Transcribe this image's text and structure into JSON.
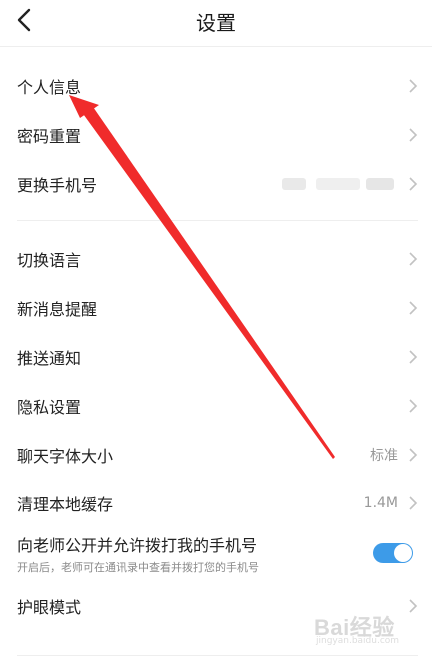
{
  "header": {
    "title": "设置",
    "back_icon": "chevron-left-icon"
  },
  "sections": [
    {
      "items": [
        {
          "label": "个人信息",
          "value": ""
        },
        {
          "label": "密码重置",
          "value": ""
        },
        {
          "label": "更换手机号",
          "value": "",
          "value_redacted": true
        }
      ]
    },
    {
      "items": [
        {
          "label": "切换语言",
          "value": ""
        },
        {
          "label": "新消息提醒",
          "value": ""
        },
        {
          "label": "推送通知",
          "value": ""
        },
        {
          "label": "隐私设置",
          "value": ""
        },
        {
          "label": "聊天字体大小",
          "value": "标准"
        },
        {
          "label": "清理本地缓存",
          "value": "1.4M"
        }
      ]
    }
  ],
  "toggle_row": {
    "label": "向老师公开并允许拨打我的手机号",
    "sublabel": "开启后，老师可在通讯录中查看并拨打您的手机号",
    "enabled": true
  },
  "eye_mode": {
    "label": "护眼模式"
  },
  "watermark": {
    "logo": "Bai经验",
    "sub": "jingyan.baidu.com"
  },
  "colors": {
    "toggle_on": "#3d9be8",
    "annotation_arrow": "#f02b2b",
    "chevron": "#c2c2c2"
  }
}
